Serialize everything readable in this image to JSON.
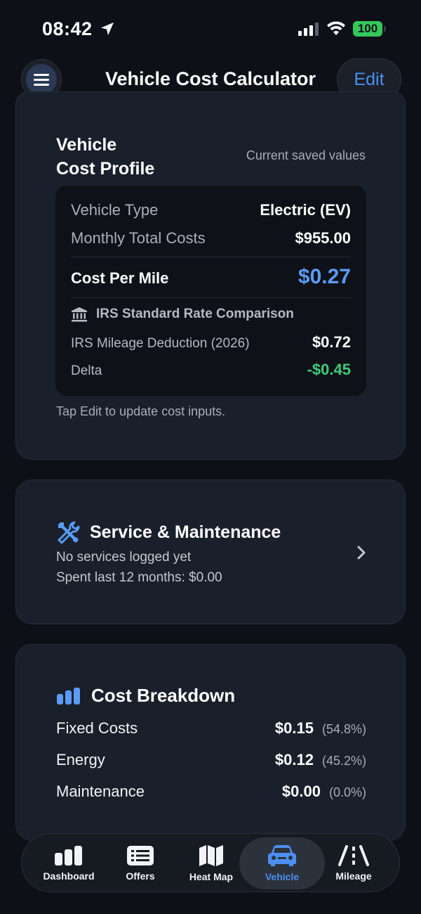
{
  "status_bar": {
    "time": "08:42",
    "battery": "100"
  },
  "header": {
    "title": "Vehicle Cost Calculator",
    "edit_label": "Edit"
  },
  "profile": {
    "title_line1": "Vehicle",
    "title_line2": "Cost Profile",
    "subtitle": "Current saved values",
    "vehicle_type_label": "Vehicle Type",
    "vehicle_type_value": "Electric (EV)",
    "monthly_label": "Monthly Total Costs",
    "monthly_value": "$955.00",
    "cpm_label": "Cost Per Mile",
    "cpm_value": "$0.27",
    "irs_heading": "IRS Standard Rate Comparison",
    "irs_label": "IRS Mileage Deduction (2026)",
    "irs_value": "$0.72",
    "delta_label": "Delta",
    "delta_value": "-$0.45",
    "hint": "Tap Edit to update cost inputs."
  },
  "service": {
    "title": "Service & Maintenance",
    "line1": "No services logged yet",
    "line2": "Spent last 12 months: $0.00"
  },
  "breakdown": {
    "title": "Cost Breakdown",
    "rows": [
      {
        "label": "Fixed Costs",
        "value": "$0.15",
        "pct": "(54.8%)"
      },
      {
        "label": "Energy",
        "value": "$0.12",
        "pct": "(45.2%)"
      },
      {
        "label": "Maintenance",
        "value": "$0.00",
        "pct": "(0.0%)"
      }
    ]
  },
  "tabs": [
    {
      "label": "Dashboard",
      "icon": "bar-chart-icon"
    },
    {
      "label": "Offers",
      "icon": "list-icon"
    },
    {
      "label": "Heat Map",
      "icon": "map-icon"
    },
    {
      "label": "Vehicle",
      "icon": "car-icon",
      "active": true
    },
    {
      "label": "Mileage",
      "icon": "road-icon"
    }
  ],
  "colors": {
    "accent": "#4d8ff0",
    "positive": "#3fcb7a",
    "battery": "#34c759"
  }
}
